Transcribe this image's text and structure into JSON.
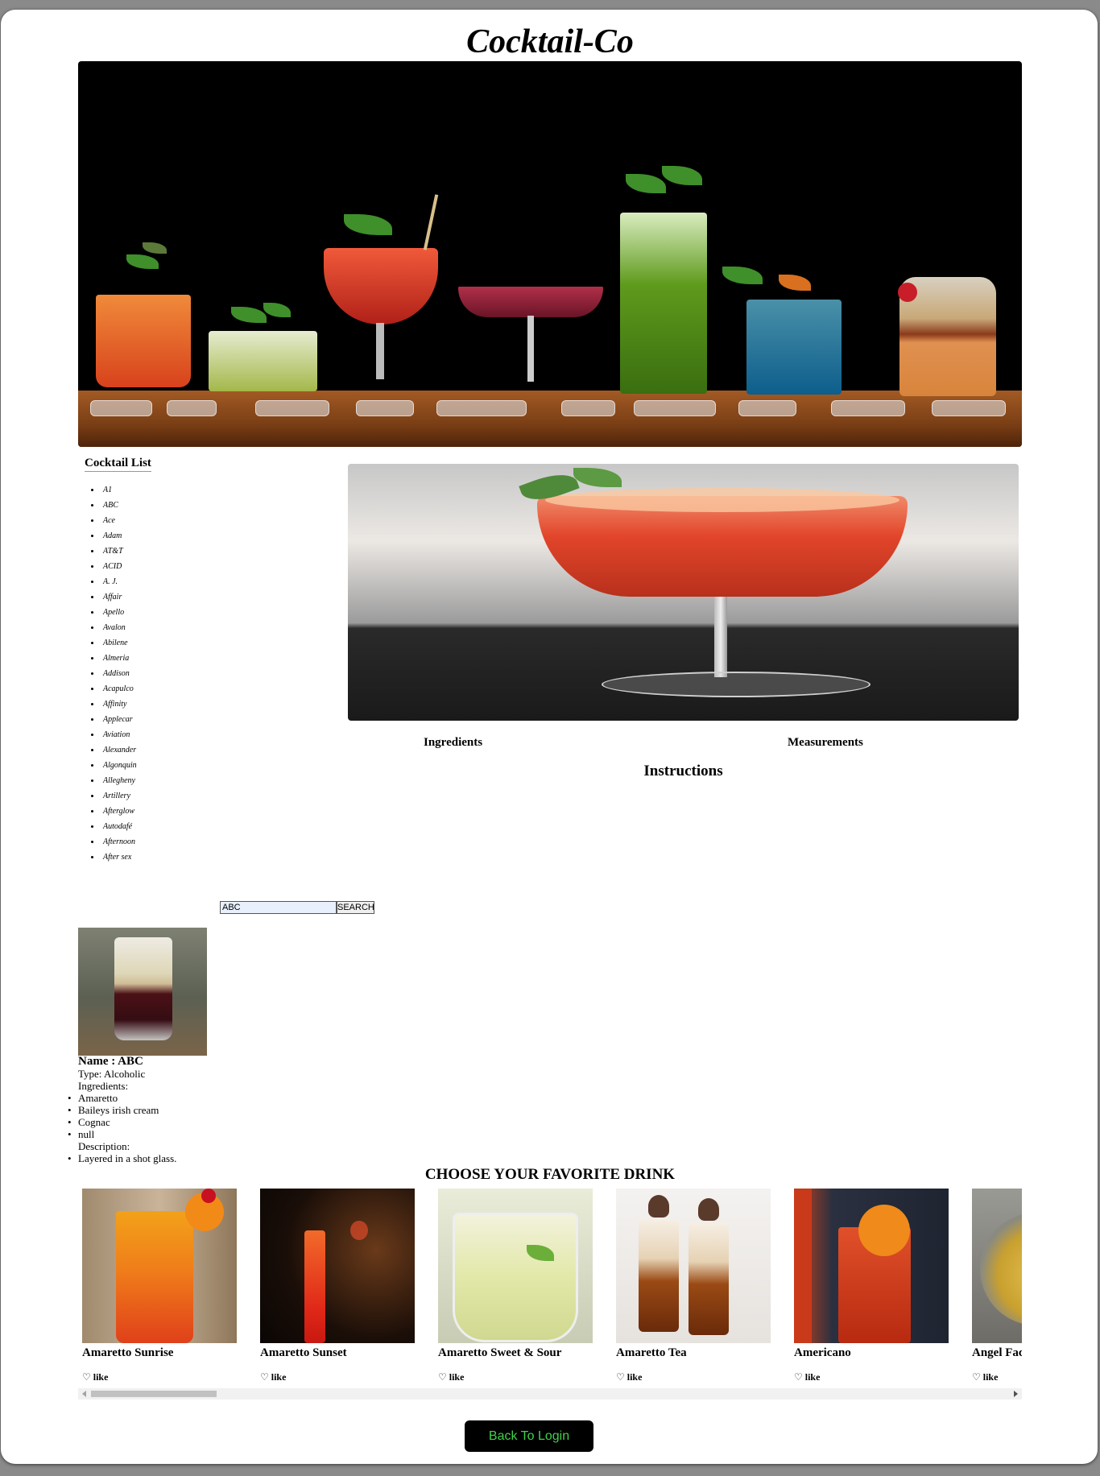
{
  "page_title": "Cocktail-Co",
  "sidebar": {
    "title": "Cocktail List",
    "items": [
      "A1",
      "ABC",
      "Ace",
      "Adam",
      "AT&T",
      "ACID",
      "A. J.",
      "Affair",
      "Apello",
      "Avalon",
      "Abilene",
      "Almeria",
      "Addison",
      "Acapulco",
      "Affinity",
      "Applecar",
      "Aviation",
      "Alexander",
      "Algonquin",
      "Allegheny",
      "Artillery",
      "Afterglow",
      "Autodafé",
      "Afternoon",
      "After sex"
    ]
  },
  "detail": {
    "ingredients_label": "Ingredients",
    "measurements_label": "Measurements",
    "instructions_label": "Instructions"
  },
  "search": {
    "value": "ABC",
    "button_label": "SEARCH"
  },
  "result": {
    "name_line": "Name : ABC",
    "type_line": "Type: Alcoholic",
    "ingredients_label": "Ingredients:",
    "ingredients": [
      "Amaretto",
      "Baileys irish cream",
      "Cognac",
      "null"
    ],
    "description_label": "Description:",
    "description": "Layered in a shot glass."
  },
  "favorites": {
    "title": "CHOOSE YOUR FAVORITE DRINK",
    "like_label": "♡ like",
    "drinks": [
      {
        "name": "Amaretto Sunrise"
      },
      {
        "name": "Amaretto Sunset"
      },
      {
        "name": "Amaretto Sweet & Sour"
      },
      {
        "name": "Amaretto Tea"
      },
      {
        "name": "Americano"
      },
      {
        "name": "Angel Face"
      }
    ]
  },
  "back_button": "Back To Login",
  "colors": {
    "button_bg": "#000000",
    "button_text": "#3fd24a",
    "search_input_bg": "#e8f0fe"
  }
}
